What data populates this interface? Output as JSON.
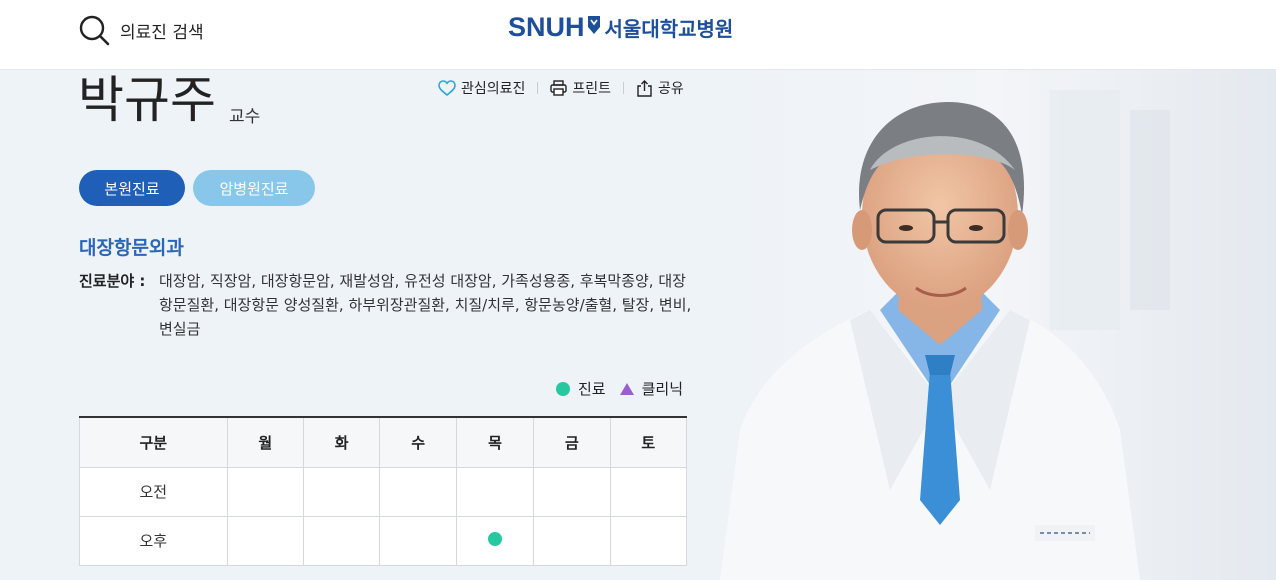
{
  "header": {
    "search_label": "의료진 검색",
    "logo_mark": "SNUH",
    "logo_name": "서울대학교병원"
  },
  "doctor": {
    "name": "박규주",
    "title": "교수",
    "department": "대장항문외과",
    "specialty_label": "진료분야 :",
    "specialty_text": "대장암, 직장암, 대장항문암, 재발성암, 유전성 대장암, 가족성용종, 후복막종양, 대장항문질환, 대장항문 양성질환, 하부위장관질환, 치질/치루, 항문농양/출혈, 탈장, 변비, 변실금"
  },
  "actions": {
    "favorite": "관심의료진",
    "print": "프린트",
    "share": "공유"
  },
  "tabs": {
    "main": "본원진료",
    "cancer": "암병원진료"
  },
  "legend": {
    "clinic": "진료",
    "special_clinic": "클리닉"
  },
  "schedule": {
    "headers": [
      "구분",
      "월",
      "화",
      "수",
      "목",
      "금",
      "토"
    ],
    "rows": [
      {
        "label": "오전",
        "cells": [
          "",
          "",
          "",
          "",
          "",
          ""
        ]
      },
      {
        "label": "오후",
        "cells": [
          "",
          "",
          "",
          "진료",
          "",
          ""
        ]
      }
    ]
  },
  "colors": {
    "brand": "#1d4f9a",
    "tab_main": "#1f5fb8",
    "tab_cancer": "#89c7ea",
    "clinic_dot": "#27c8a0",
    "special_triangle": "#9a5fcf"
  }
}
